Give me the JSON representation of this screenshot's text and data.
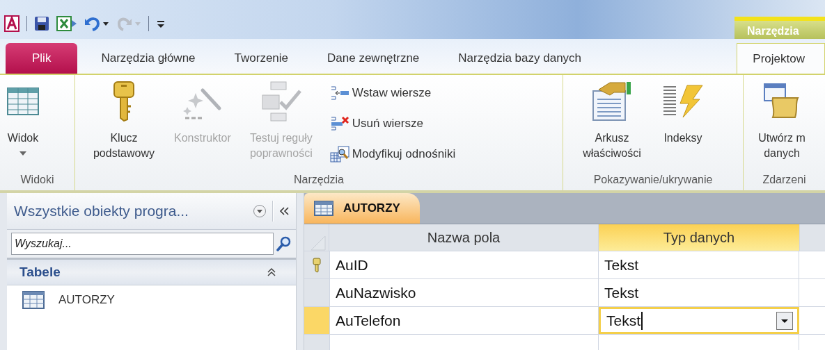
{
  "contextual_header": {
    "label": "Narzędzia"
  },
  "ribbon_tabs": [
    {
      "label": "Plik",
      "kind": "file",
      "selected": false
    },
    {
      "label": "Narzędzia główne",
      "kind": "normal",
      "selected": false
    },
    {
      "label": "Tworzenie",
      "kind": "normal",
      "selected": false
    },
    {
      "label": "Dane zewnętrzne",
      "kind": "normal",
      "selected": false
    },
    {
      "label": "Narzędzia bazy danych",
      "kind": "normal",
      "selected": false
    },
    {
      "label": "Projektow",
      "kind": "contextual",
      "selected": true
    }
  ],
  "ribbon_groups": [
    {
      "label": "Widoki",
      "buttons": [
        {
          "label": "Widok",
          "kind": "large",
          "disabled": false,
          "dropdown": true
        }
      ]
    },
    {
      "label": "Narzędzia",
      "buttons": [
        {
          "label": "Klucz podstawowy",
          "kind": "large",
          "disabled": false
        },
        {
          "label": "Konstruktor",
          "kind": "large",
          "disabled": true
        },
        {
          "label": "Testuj reguły poprawności",
          "kind": "large",
          "disabled": true
        },
        {
          "label": "Wstaw wiersze",
          "kind": "small",
          "disabled": false
        },
        {
          "label": "Usuń wiersze",
          "kind": "small",
          "disabled": false
        },
        {
          "label": "Modyfikuj odnośniki",
          "kind": "small",
          "disabled": false
        }
      ]
    },
    {
      "label": "Pokazywanie/ukrywanie",
      "buttons": [
        {
          "label": "Arkusz właściwości",
          "kind": "large",
          "disabled": false
        },
        {
          "label": "Indeksy",
          "kind": "large",
          "disabled": false
        }
      ]
    },
    {
      "label": "Zdarzeni",
      "buttons": [
        {
          "label": "Utwórz m danych",
          "kind": "large",
          "disabled": false
        }
      ]
    }
  ],
  "nav_pane": {
    "title": "Wszystkie obiekty progra...",
    "search": {
      "placeholder": "Wyszukaj..."
    },
    "groups": [
      {
        "label": "Tabele",
        "expanded": true,
        "items": [
          {
            "label": "AUTORZY",
            "selected": false
          }
        ]
      }
    ]
  },
  "document_tab": {
    "label": "AUTORZY"
  },
  "grid": {
    "columns": [
      {
        "label": "Nazwa pola",
        "selected": false
      },
      {
        "label": "Typ danych",
        "selected": true
      }
    ],
    "rows": [
      {
        "field": "AuID",
        "type": "Tekst",
        "primary_key": true,
        "selected": false
      },
      {
        "field": "AuNazwisko",
        "type": "Tekst",
        "primary_key": false,
        "selected": false
      },
      {
        "field": "AuTelefon",
        "type": "Tekst",
        "primary_key": false,
        "selected": true
      }
    ]
  }
}
